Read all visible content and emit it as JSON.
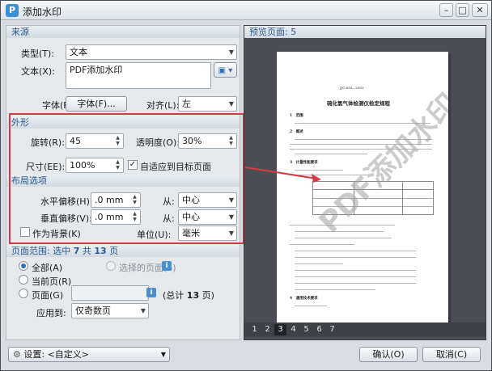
{
  "window": {
    "title": "添加水印",
    "app_icon_letter": "P"
  },
  "source": {
    "section_title": "来源",
    "type_label": "类型(T):",
    "type_value": "文本",
    "text_label": "文本(X):",
    "text_value": "PDF添加水印",
    "font_label": "字体(F):",
    "font_button": "字体(F)...",
    "align_label": "对齐(L):",
    "align_value": "左"
  },
  "appearance": {
    "section_title": "外形",
    "rotation_label": "旋转(R):",
    "rotation_value": "45",
    "opacity_label": "透明度(O):",
    "opacity_value": "30%",
    "size_label": "尺寸(EE):",
    "size_value": "100%",
    "fit_label": "自适应到目标页面"
  },
  "layout": {
    "section_title": "布局选项",
    "h_offset_label": "水平偏移(H):",
    "h_offset_value": ".0 mm",
    "h_from_label": "从:",
    "h_from_value": "中心",
    "v_offset_label": "垂直偏移(V):",
    "v_offset_value": ".0 mm",
    "v_from_label": "从:",
    "v_from_value": "中心",
    "background_label": "作为背景(K)",
    "unit_label": "单位(U):",
    "unit_value": "毫米"
  },
  "page_range": {
    "section_title_prefix": "页面范围: 选中",
    "selected": "7",
    "connector": "共",
    "total": "13",
    "suffix": "页",
    "all_label": "全部(A)",
    "selected_pages_label": "选择的页面(S)",
    "current_label": "当前页(R)",
    "pages_label": "页面(G)",
    "total_note_prefix": "(总计",
    "total_note_value": "13",
    "total_note_suffix": "页)",
    "apply_label": "应用到:",
    "apply_value": "仅奇数页"
  },
  "preview": {
    "title": "预览页面: 5",
    "doc_number": "JJG 693—2003",
    "doc_title": "硫化氢气体检测仪检定规程",
    "s1": "1　范围",
    "s2": "2　概述",
    "s3": "3　计量性能要求",
    "s4": "4　通用技术要求",
    "watermark": "PDF添加水印",
    "pages": [
      "1",
      "2",
      "3",
      "4",
      "5",
      "6",
      "7"
    ],
    "active_page": "3"
  },
  "footer": {
    "settings_label": "设置:",
    "settings_value": "<自定义>",
    "ok_button": "确认(O)",
    "cancel_button": "取消(C)"
  },
  "colors": {
    "highlight_red": "#d63a46",
    "accent_blue": "#2a5a8c"
  }
}
